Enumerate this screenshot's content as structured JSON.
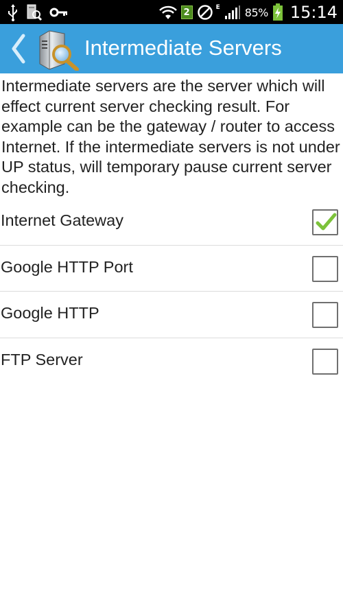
{
  "status_bar": {
    "badge_count": "2",
    "network_type": "E",
    "battery": "85%",
    "time": "15:14",
    "icons": [
      "usb-icon",
      "server-search-icon",
      "key-icon",
      "wifi-icon",
      "notification-badge-icon",
      "blocked-icon",
      "signal-icon",
      "battery-charging-icon"
    ]
  },
  "action_bar": {
    "title": "Intermediate Servers",
    "color": "#3a9fdc"
  },
  "description": "Intermediate servers are the server which will effect current server checking result. For example can be the gateway / router to access Internet. If the intermediate servers is not under UP status, will temporary pause current server checking.",
  "servers": [
    {
      "label": "Internet Gateway",
      "checked": true
    },
    {
      "label": "Google HTTP Port",
      "checked": false
    },
    {
      "label": "Google HTTP",
      "checked": false
    },
    {
      "label": "FTP Server",
      "checked": false
    }
  ],
  "colors": {
    "check_mark": "#7cc23a"
  }
}
